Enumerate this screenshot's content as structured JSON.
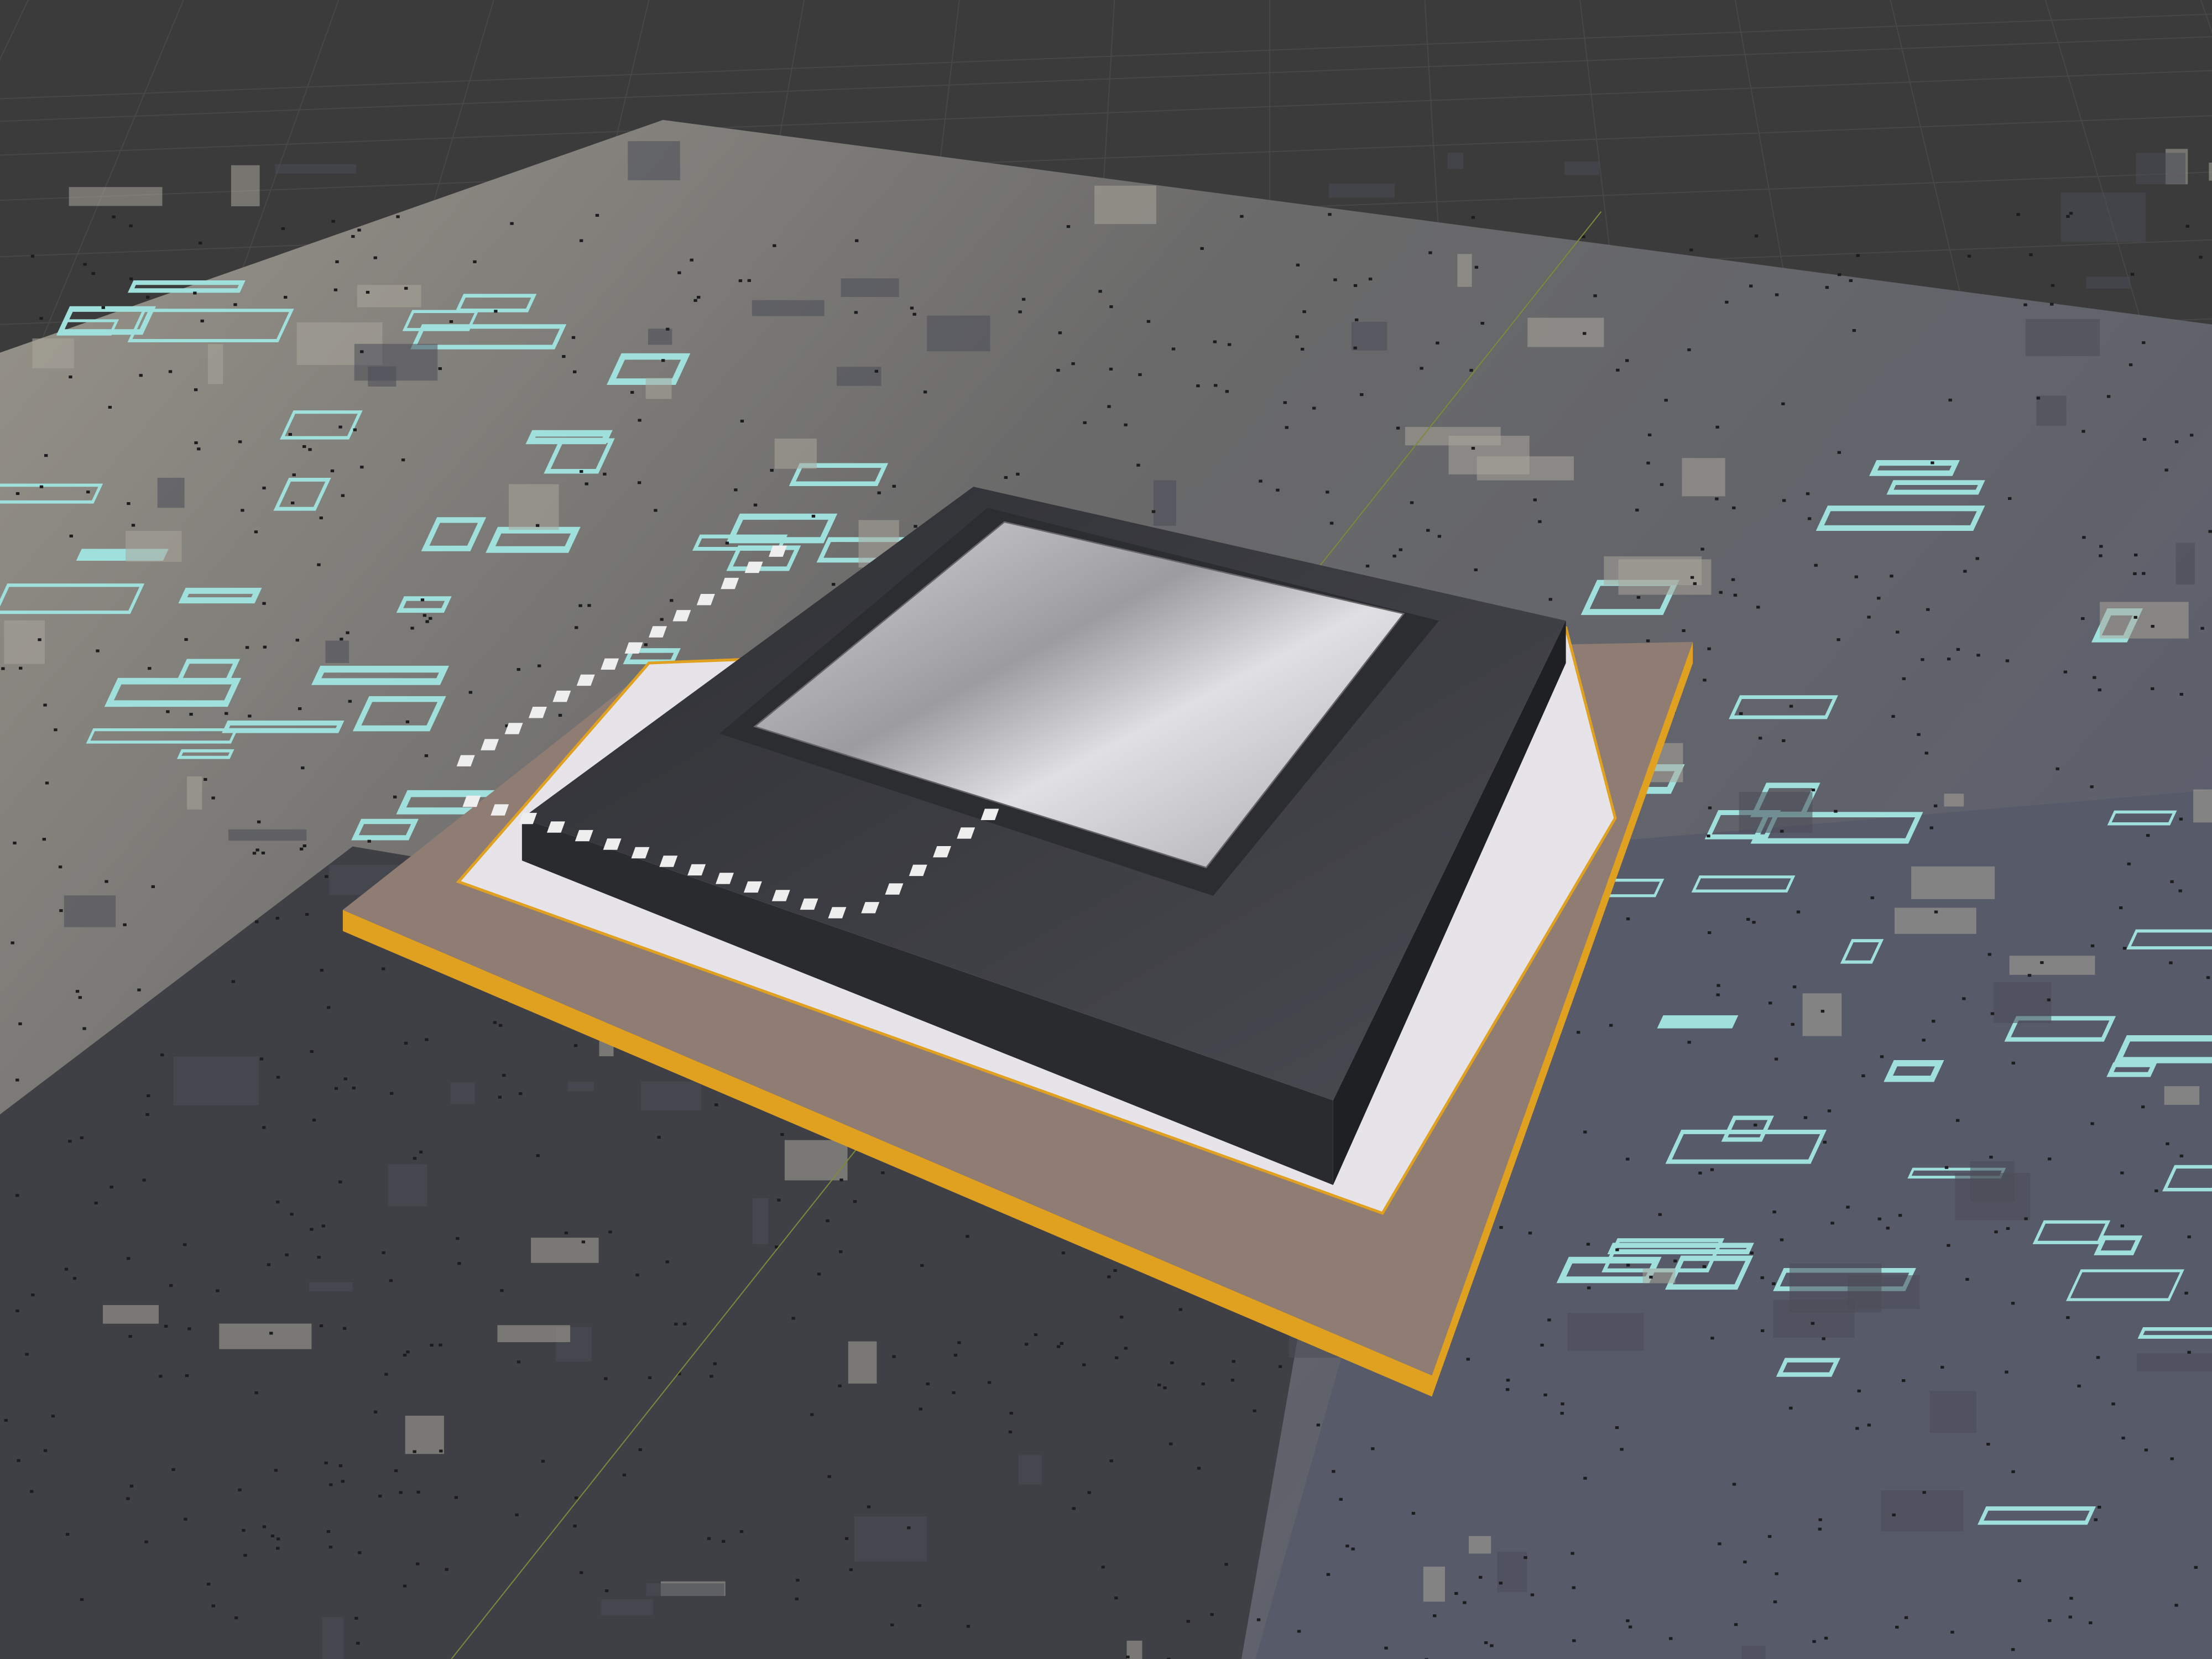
{
  "viewport": {
    "colors": {
      "background": "#3b3b3b",
      "grid": "#474747",
      "axis_line": "#7d8a3a",
      "board_left": "#8c887e",
      "board_right": "#5e6170",
      "board_dark": "#3f4046",
      "trace_cyan": "#9fe0dc",
      "substrate": "#8f7c72",
      "substrate_edge": "#e0a020",
      "frame_white": "#e6e4e8",
      "package_dark": "#3a3b40",
      "die_silver": "#b8b8bc",
      "pad": "#eeeeee"
    },
    "pads_per_side": 14,
    "vias_count": 900
  }
}
